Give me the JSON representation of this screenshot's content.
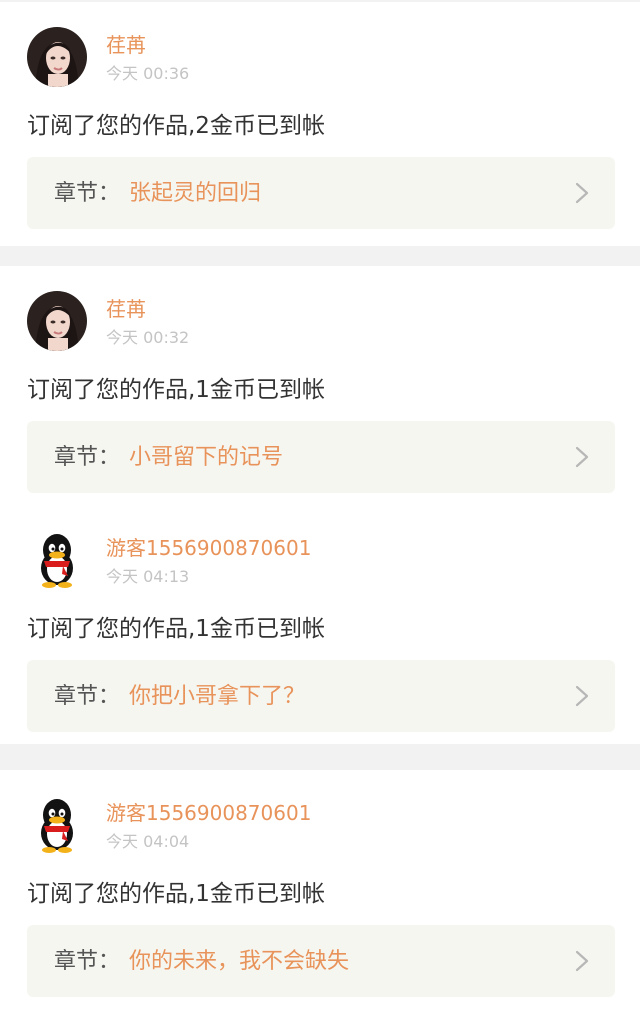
{
  "notifications": [
    {
      "avatar": "female-portrait-avatar",
      "username": "荏苒",
      "time": "今天 00:36",
      "message": "订阅了您的作品,2金币已到帐",
      "chapter_prefix": "章节：",
      "chapter_title": "张起灵的回归"
    },
    {
      "avatar": "female-portrait-avatar",
      "username": "荏苒",
      "time": "今天 00:32",
      "message": "订阅了您的作品,1金币已到帐",
      "chapter_prefix": "章节：",
      "chapter_title": "小哥留下的记号"
    },
    {
      "avatar": "qq-penguin-avatar",
      "username": "游客1556900870601",
      "time": "今天 04:13",
      "message": "订阅了您的作品,1金币已到帐",
      "chapter_prefix": "章节：",
      "chapter_title": "你把小哥拿下了？"
    },
    {
      "avatar": "qq-penguin-avatar",
      "username": "游客1556900870601",
      "time": "今天 04:04",
      "message": "订阅了您的作品,1金币已到帐",
      "chapter_prefix": "章节：",
      "chapter_title": "你的未来，我不会缺失"
    }
  ],
  "colors": {
    "accent": "#e8935a",
    "time": "#c4c4c4",
    "message": "#333333",
    "chapter_box": "#f6f6f1",
    "background": "#f2f2f2"
  }
}
